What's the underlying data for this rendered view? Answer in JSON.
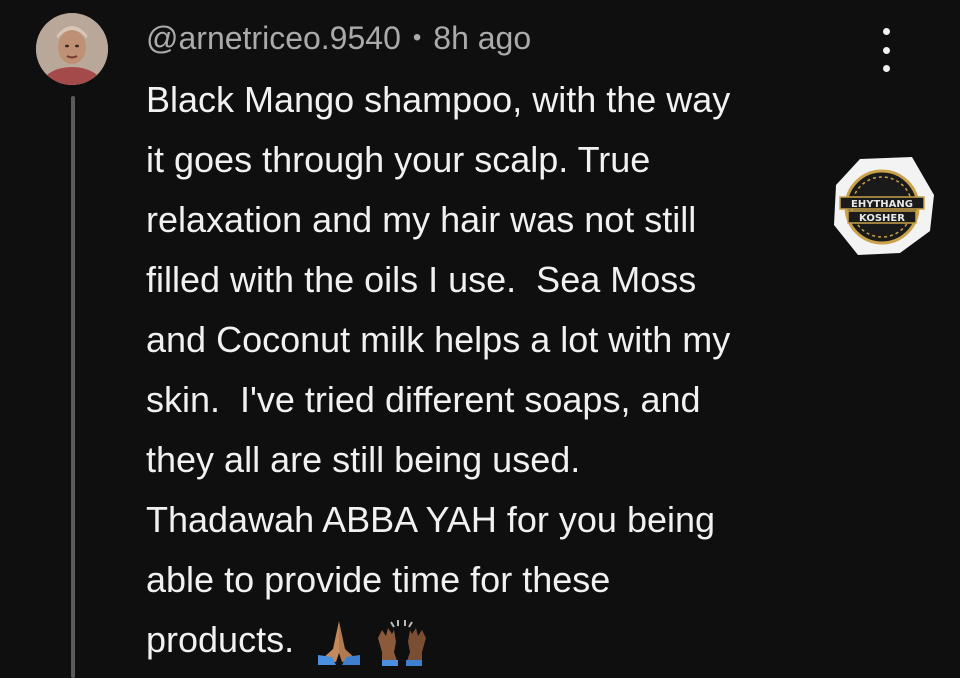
{
  "comment": {
    "username": "@arnetriceo.9540",
    "separator": "•",
    "timestamp": "8h ago",
    "body_lines": [
      "Black Mango shampoo, with the way",
      "it goes through your scalp. True",
      "relaxation and my hair was not still",
      "filled with the oils I use.  Sea Moss",
      "and Coconut milk helps a lot with my",
      "skin.  I've tried different soaps, and",
      "they all are still being used.",
      "Thadawah ABBA YAH for you being",
      "able to provide time for these",
      "products."
    ],
    "emojis": [
      "folded-hands-emoji",
      "raising-hands-emoji"
    ]
  },
  "icons": {
    "more": "more-vertical-icon"
  },
  "sticker": {
    "line1": "EHYTHANG",
    "line2": "KOSHER"
  },
  "colors": {
    "background": "#0f0f0f",
    "text": "#f1f1f1",
    "meta": "#aaaaaa",
    "thread_line": "#5a5a5a"
  }
}
